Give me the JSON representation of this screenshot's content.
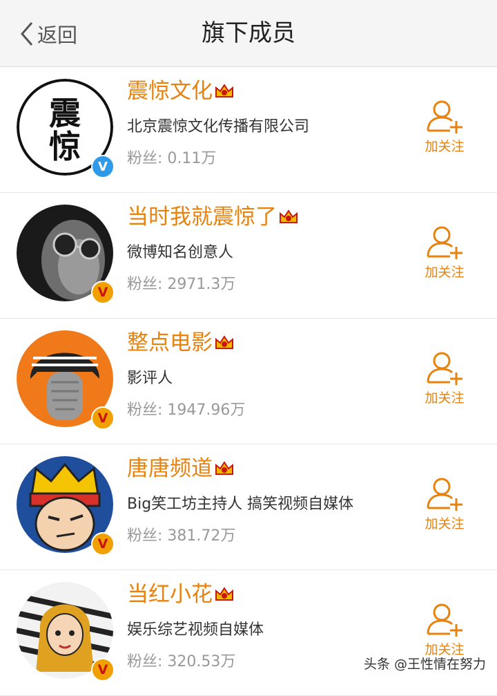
{
  "header": {
    "back_label": "返回",
    "title": "旗下成员"
  },
  "members": [
    {
      "name": "震惊文化",
      "description": "北京震惊文化传播有限公司",
      "fans": "粉丝: 0.11万",
      "badge_letter": "V",
      "badge_color": "blue",
      "follow_label": "加关注"
    },
    {
      "name": "当时我就震惊了",
      "description": "微博知名创意人",
      "fans": "粉丝: 2971.3万",
      "badge_letter": "V",
      "badge_color": "orange",
      "follow_label": "加关注"
    },
    {
      "name": "整点电影",
      "description": "影评人",
      "fans": "粉丝: 1947.96万",
      "badge_letter": "V",
      "badge_color": "orange",
      "follow_label": "加关注"
    },
    {
      "name": "唐唐频道",
      "description": "Big笑工坊主持人 搞笑视频自媒体",
      "fans": "粉丝: 381.72万",
      "badge_letter": "V",
      "badge_color": "orange",
      "follow_label": "加关注"
    },
    {
      "name": "当红小花",
      "description": "娱乐综艺视频自媒体",
      "fans": "粉丝: 320.53万",
      "badge_letter": "V",
      "badge_color": "orange",
      "follow_label": "加关注"
    }
  ],
  "avatar_logo_text": [
    "震",
    "惊"
  ],
  "watermark": "头条 @王性情在努力",
  "colors": {
    "accent": "#e8820e",
    "verified_blue": "#2e9ae8",
    "verified_orange": "#f0a000"
  }
}
